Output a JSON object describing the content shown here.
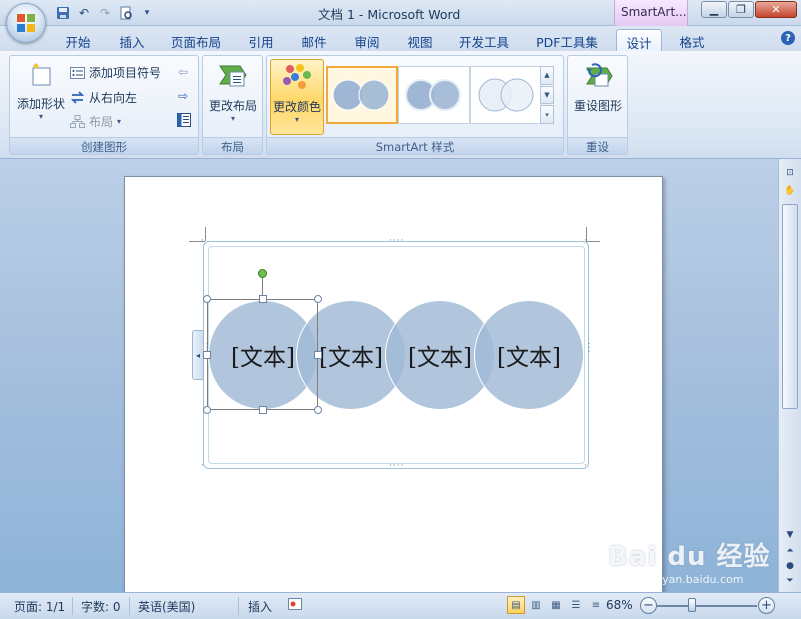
{
  "titlebar": {
    "document_title": "文档 1 - Microsoft Word",
    "contextual_tab": "SmartArt..."
  },
  "tabs": [
    {
      "label": "开始"
    },
    {
      "label": "插入"
    },
    {
      "label": "页面布局"
    },
    {
      "label": "引用"
    },
    {
      "label": "邮件"
    },
    {
      "label": "审阅"
    },
    {
      "label": "视图"
    },
    {
      "label": "开发工具"
    },
    {
      "label": "PDF工具集"
    },
    {
      "label": "设计",
      "active": true
    },
    {
      "label": "格式"
    }
  ],
  "ribbon": {
    "create_graphic": {
      "label": "创建图形",
      "add_shape": "添加形状",
      "add_bullet": "添加项目符号",
      "right_to_left": "从右向左",
      "layout": "布局"
    },
    "layouts": {
      "label": "布局",
      "change_layout": "更改布局"
    },
    "styles": {
      "label": "SmartArt 样式",
      "change_colors": "更改颜色"
    },
    "reset": {
      "label": "重设",
      "reset_graphic": "重设图形"
    }
  },
  "smartart": {
    "shapes": [
      {
        "text": "[文本]"
      },
      {
        "text": "[文本]"
      },
      {
        "text": "[文本]"
      },
      {
        "text": "[文本]"
      }
    ]
  },
  "statusbar": {
    "page": "页面: 1/1",
    "words": "字数: 0",
    "language": "英语(美国)",
    "mode": "插入",
    "zoom": "68%"
  },
  "watermark": {
    "brand": "Bai du 经验",
    "url": "jingyan.baidu.com"
  },
  "colors": {
    "circle_fill": "#a0b9d6",
    "selection_border": "#7d7d7d",
    "accent_tab": "#e4c9f3"
  }
}
